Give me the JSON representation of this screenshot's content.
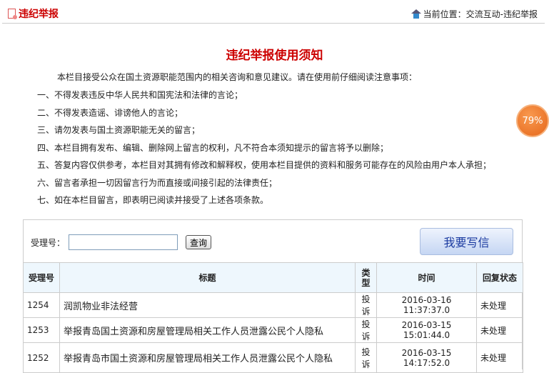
{
  "header": {
    "title": "违纪举报",
    "breadcrumb": "当前位置：交流互动-违纪举报"
  },
  "notice": {
    "title": "违纪举报使用须知",
    "intro": "本栏目接受公众在国土资源职能范围内的相关咨询和意见建议。请在使用前仔细阅读注意事项：",
    "rules": [
      "一、不得发表违反中华人民共和国宪法和法律的言论；",
      "二、不得发表造谣、诽谤他人的言论；",
      "三、请勿发表与国土资源职能无关的留言；",
      "四、本栏目拥有发布、编辑、删除网上留言的权利，凡不符合本须知提示的留言将予以删除；",
      "五、答复内容仅供参考，本栏目对其拥有修改和解释权，使用本栏目提供的资料和服务可能存在的风险由用户本人承担；",
      "六、留言者承担一切因留言行为而直接或间接引起的法律责任；",
      "七、如在本栏目留言，即表明已阅读并接受了上述各项条款。"
    ]
  },
  "badge": "79%",
  "search": {
    "label": "受理号：",
    "value": "",
    "button": "查询"
  },
  "write_button": "我要写信",
  "table": {
    "headers": [
      "受理号",
      "标题",
      "类型",
      "时间",
      "回复状态"
    ],
    "rows": [
      [
        "1254",
        "润凯物业非法经营",
        "投诉",
        "2016-03-16 11:37:37.0",
        "未处理"
      ],
      [
        "1253",
        "举报青岛国土资源和房屋管理局相关工作人员泄露公民个人隐私",
        "投诉",
        "2016-03-15 15:01:44.0",
        "未处理"
      ],
      [
        "1252",
        "举报青岛市国土资源和房屋管理局相关工作人员泄露公民个人隐私",
        "投诉",
        "2016-03-15 14:17:52.0",
        "未处理"
      ]
    ]
  }
}
